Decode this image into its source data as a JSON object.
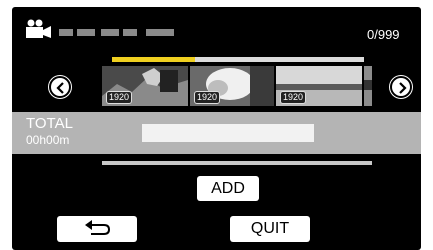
{
  "header": {
    "mode_icon": "video-camera-icon",
    "counter": "0/999"
  },
  "navigation": {
    "prev_icon": "chevron-left-icon",
    "next_icon": "chevron-right-icon"
  },
  "playlist": {
    "progress_fraction": 0.33,
    "thumbnails": [
      {
        "badge": "1920",
        "icon": "scene-thumbnail"
      },
      {
        "badge": "1920",
        "icon": "scene-thumbnail"
      },
      {
        "badge": "1920",
        "icon": "scene-thumbnail"
      },
      {
        "badge": "",
        "icon": "scene-thumbnail-partial"
      }
    ]
  },
  "total": {
    "label": "TOTAL",
    "time": "00h00m"
  },
  "buttons": {
    "add_label": "ADD",
    "back_icon": "return-arrow-icon",
    "quit_label": "QUIT"
  }
}
